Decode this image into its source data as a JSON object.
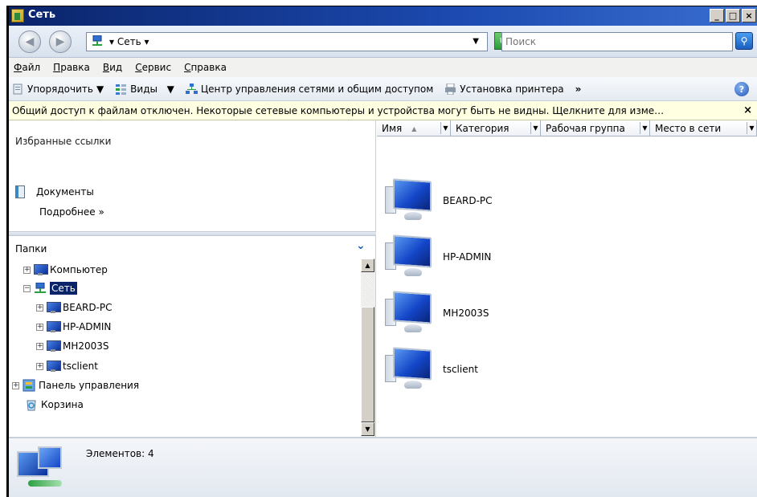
{
  "window": {
    "title": "Сеть"
  },
  "title_buttons": {
    "minimize": "_",
    "maximize": "□",
    "close": "×"
  },
  "address": {
    "location": "Сеть",
    "search_placeholder": "Поиск"
  },
  "menu": [
    "Файл",
    "Правка",
    "Вид",
    "Сервис",
    "Справка"
  ],
  "toolbar": {
    "organize": "Упорядочить",
    "views": "Виды",
    "network_center": "Центр управления сетями и общим доступом",
    "add_printer": "Установка принтера",
    "more": "»"
  },
  "infobar": {
    "text": "Общий доступ к файлам отключен. Некоторые сетевые компьютеры и устройства могут быть не видны. Щелкните для изме…",
    "close": "×"
  },
  "nav": {
    "favorites_title": "Избранные ссылки",
    "documents": "Документы",
    "more": "Подробнее  »",
    "folders_title": "Папки",
    "tree": [
      {
        "label": "Компьютер",
        "level": 0,
        "expander": "+"
      },
      {
        "label": "Сеть",
        "level": 0,
        "expander": "−",
        "selected": true
      },
      {
        "label": "BEARD-PC",
        "level": 1,
        "expander": "+"
      },
      {
        "label": "HP-ADMIN",
        "level": 1,
        "expander": "+"
      },
      {
        "label": "MH2003S",
        "level": 1,
        "expander": "+"
      },
      {
        "label": "tsclient",
        "level": 1,
        "expander": "+"
      },
      {
        "label": "Панель управления",
        "level": 0,
        "expander": "+"
      },
      {
        "label": "Корзина",
        "level": 0,
        "expander": ""
      }
    ]
  },
  "columns": [
    "Имя",
    "Категория",
    "Рабочая группа",
    "Место в сети"
  ],
  "items": [
    "BEARD-PC",
    "HP-ADMIN",
    "MH2003S",
    "tsclient"
  ],
  "details": {
    "count_text": "Элементов: 4"
  },
  "colors": {
    "title_bar": "#0a246a",
    "infobar": "#ffffe1",
    "selection": "#0a246a"
  }
}
